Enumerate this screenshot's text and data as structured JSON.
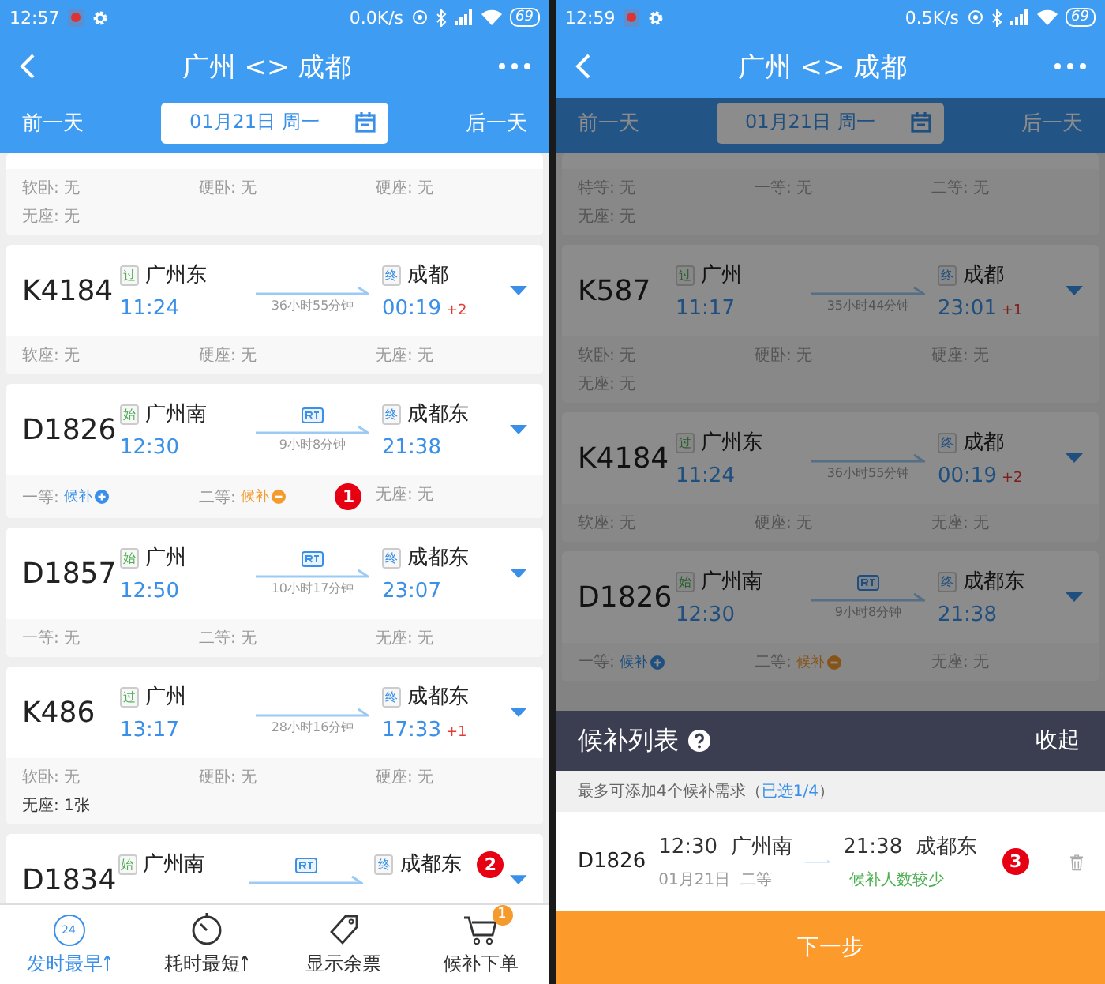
{
  "screens": [
    {
      "status_bar": {
        "time": "12:57",
        "speed": "0.0K/s",
        "battery": "69"
      },
      "nav": {
        "title": "广州 <> 成都"
      },
      "date_bar": {
        "prev": "前一天",
        "date": "01月21日 周一",
        "next": "后一天"
      },
      "dimmed": false,
      "trains": [
        {
          "kind": "seats_only",
          "seats": [
            {
              "kind": "text",
              "text": "软卧: 无",
              "available": false
            },
            {
              "kind": "text",
              "text": "硬卧: 无",
              "available": false
            },
            {
              "kind": "text",
              "text": "硬座: 无",
              "available": false
            },
            {
              "kind": "text",
              "text": "无座: 无",
              "available": false
            }
          ]
        },
        {
          "kind": "full",
          "number": "K4184",
          "from_tag": "过",
          "from": "广州东",
          "depart": "11:24",
          "train_icon": false,
          "duration": "36小时55分钟",
          "to_tag": "终",
          "to": "成都",
          "arrive": "00:19",
          "day_offset": "+2",
          "seats": [
            {
              "kind": "text",
              "text": "软座: 无",
              "available": false
            },
            {
              "kind": "text",
              "text": "硬座: 无",
              "available": false
            },
            {
              "kind": "text",
              "text": "无座: 无",
              "available": false
            }
          ]
        },
        {
          "kind": "full",
          "number": "D1826",
          "from_tag": "始",
          "from": "广州南",
          "depart": "12:30",
          "train_icon": true,
          "duration": "9小时8分钟",
          "to_tag": "终",
          "to": "成都东",
          "arrive": "21:38",
          "seats": [
            {
              "kind": "waitlist",
              "label": "一等:",
              "action": "候补",
              "selected": false
            },
            {
              "kind": "waitlist",
              "label": "二等:",
              "action": "候补",
              "selected": true,
              "marker": "1"
            },
            {
              "kind": "text",
              "text": "无座: 无",
              "available": false
            }
          ]
        },
        {
          "kind": "full",
          "number": "D1857",
          "from_tag": "始",
          "from": "广州",
          "depart": "12:50",
          "train_icon": true,
          "duration": "10小时17分钟",
          "to_tag": "终",
          "to": "成都东",
          "arrive": "23:07",
          "seats": [
            {
              "kind": "text",
              "text": "一等: 无",
              "available": false
            },
            {
              "kind": "text",
              "text": "二等: 无",
              "available": false
            },
            {
              "kind": "text",
              "text": "无座: 无",
              "available": false
            }
          ]
        },
        {
          "kind": "full",
          "number": "K486",
          "from_tag": "过",
          "from": "广州",
          "depart": "13:17",
          "train_icon": false,
          "duration": "28小时16分钟",
          "to_tag": "终",
          "to": "成都东",
          "arrive": "17:33",
          "day_offset": "+1",
          "seats": [
            {
              "kind": "text",
              "text": "软卧: 无",
              "available": false
            },
            {
              "kind": "text",
              "text": "硬卧: 无",
              "available": false
            },
            {
              "kind": "text",
              "text": "硬座: 无",
              "available": false
            },
            {
              "kind": "text",
              "text": "无座: 1张",
              "available": true
            }
          ]
        },
        {
          "kind": "full",
          "number": "D1834",
          "from_tag": "始",
          "from": "广州南",
          "train_icon": true,
          "to_tag": "终",
          "to": "成都东",
          "marker": "2"
        }
      ],
      "tab_bar": [
        {
          "kind": "clock",
          "label": "发时最早",
          "icon_text": "24",
          "selected": true,
          "sortable": true
        },
        {
          "kind": "timer",
          "label": "耗时最短",
          "selected": false,
          "sortable": true
        },
        {
          "kind": "tag",
          "label": "显示余票",
          "selected": false,
          "sortable": false
        },
        {
          "kind": "cart",
          "label": "候补下单",
          "selected": false,
          "sortable": false,
          "badge": "1"
        }
      ]
    },
    {
      "status_bar": {
        "time": "12:59",
        "speed": "0.5K/s",
        "battery": "69"
      },
      "nav": {
        "title": "广州 <> 成都"
      },
      "date_bar": {
        "prev": "前一天",
        "date": "01月21日 周一",
        "next": "后一天"
      },
      "dimmed": true,
      "trains": [
        {
          "kind": "seats_only",
          "seats": [
            {
              "kind": "text",
              "text": "特等: 无",
              "available": false
            },
            {
              "kind": "text",
              "text": "一等: 无",
              "available": false
            },
            {
              "kind": "text",
              "text": "二等: 无",
              "available": false
            },
            {
              "kind": "text",
              "text": "无座: 无",
              "available": false
            }
          ]
        },
        {
          "kind": "full",
          "number": "K587",
          "from_tag": "过",
          "from": "广州",
          "depart": "11:17",
          "train_icon": false,
          "duration": "35小时44分钟",
          "to_tag": "终",
          "to": "成都",
          "arrive": "23:01",
          "day_offset": "+1",
          "seats": [
            {
              "kind": "text",
              "text": "软卧: 无",
              "available": false
            },
            {
              "kind": "text",
              "text": "硬卧: 无",
              "available": false
            },
            {
              "kind": "text",
              "text": "硬座: 无",
              "available": false
            },
            {
              "kind": "text",
              "text": "无座: 无",
              "available": false
            }
          ]
        },
        {
          "kind": "full",
          "number": "K4184",
          "from_tag": "过",
          "from": "广州东",
          "depart": "11:24",
          "train_icon": false,
          "duration": "36小时55分钟",
          "to_tag": "终",
          "to": "成都",
          "arrive": "00:19",
          "day_offset": "+2",
          "seats": [
            {
              "kind": "text",
              "text": "软座: 无",
              "available": false
            },
            {
              "kind": "text",
              "text": "硬座: 无",
              "available": false
            },
            {
              "kind": "text",
              "text": "无座: 无",
              "available": false
            }
          ]
        },
        {
          "kind": "full",
          "number": "D1826",
          "from_tag": "始",
          "from": "广州南",
          "depart": "12:30",
          "train_icon": true,
          "duration": "9小时8分钟",
          "to_tag": "终",
          "to": "成都东",
          "arrive": "21:38",
          "seats": [
            {
              "kind": "waitlist",
              "label": "一等:",
              "action": "候补",
              "selected": false
            },
            {
              "kind": "waitlist",
              "label": "二等:",
              "action": "候补",
              "selected": true
            },
            {
              "kind": "text",
              "text": "无座: 无",
              "available": false
            }
          ]
        }
      ],
      "waitlist_panel": {
        "title": "候补列表",
        "collapse": "收起",
        "note_prefix": "最多可添加4个候补需求（",
        "note_count": "已选1/4",
        "note_suffix": "）",
        "items": [
          {
            "number": "D1826",
            "depart": "12:30",
            "from": "广州南",
            "arrive": "21:38",
            "to": "成都东",
            "date": "01月21日",
            "seat": "二等",
            "status": "候补人数较少",
            "marker": "3"
          }
        ],
        "next_button": "下一步"
      }
    }
  ]
}
